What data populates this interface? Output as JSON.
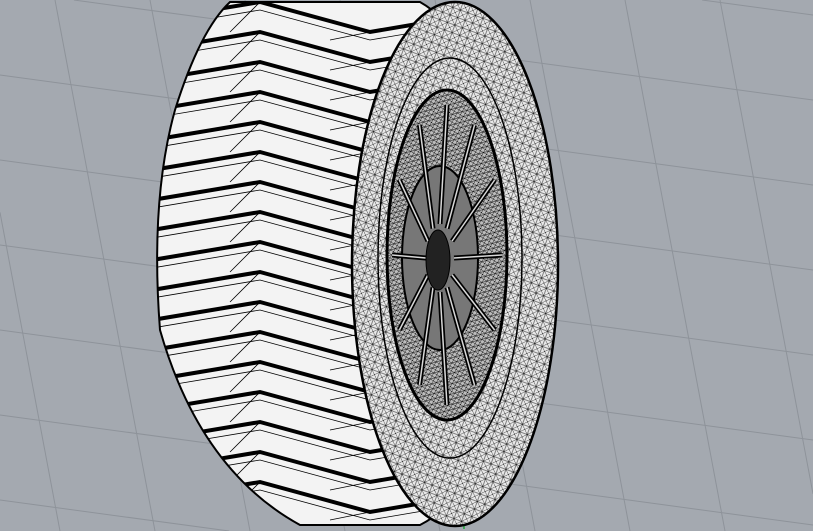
{
  "viewport": {
    "view_mode": "wireframe",
    "object": "tire-mesh",
    "colors": {
      "background": "#a4a9b0",
      "grid_line": "#8e939a",
      "mesh_fill": "#f2f2f2",
      "mesh_line": "#000000",
      "y_axis": "#1fa83a"
    }
  }
}
